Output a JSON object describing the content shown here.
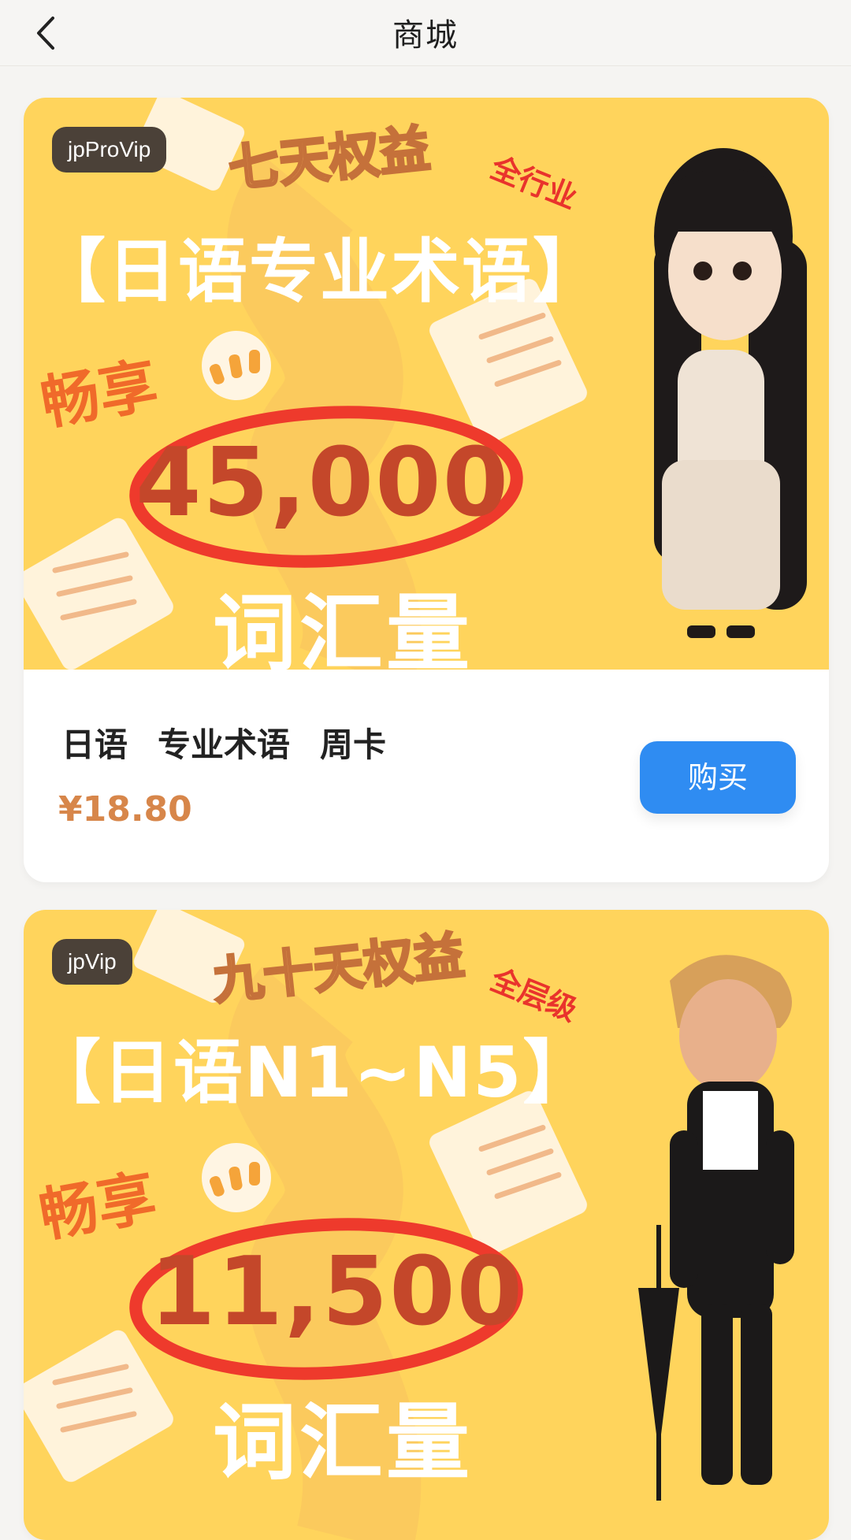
{
  "header": {
    "title": "商城"
  },
  "products": [
    {
      "tag": "jpProVip",
      "banner": {
        "perk_title": "七天权益",
        "perk_badge": "全行业",
        "main_title": "【日语专业术语】",
        "enjoy": "畅享",
        "number": "45,000",
        "vocab_label": "词汇量"
      },
      "name_parts": [
        "日语",
        "专业术语",
        "周卡"
      ],
      "price": "¥18.80",
      "buy_label": "购买"
    },
    {
      "tag": "jpVip",
      "banner": {
        "perk_title": "九十天权益",
        "perk_badge": "全层级",
        "main_title": "【日语N1~N5】",
        "enjoy": "畅享",
        "number": "11,500",
        "vocab_label": "词汇量"
      }
    }
  ],
  "colors": {
    "banner_bg": "#ffd45c",
    "buy_button": "#2f8cf2",
    "price": "#d7864a",
    "tag_bg": "#4b4138"
  }
}
